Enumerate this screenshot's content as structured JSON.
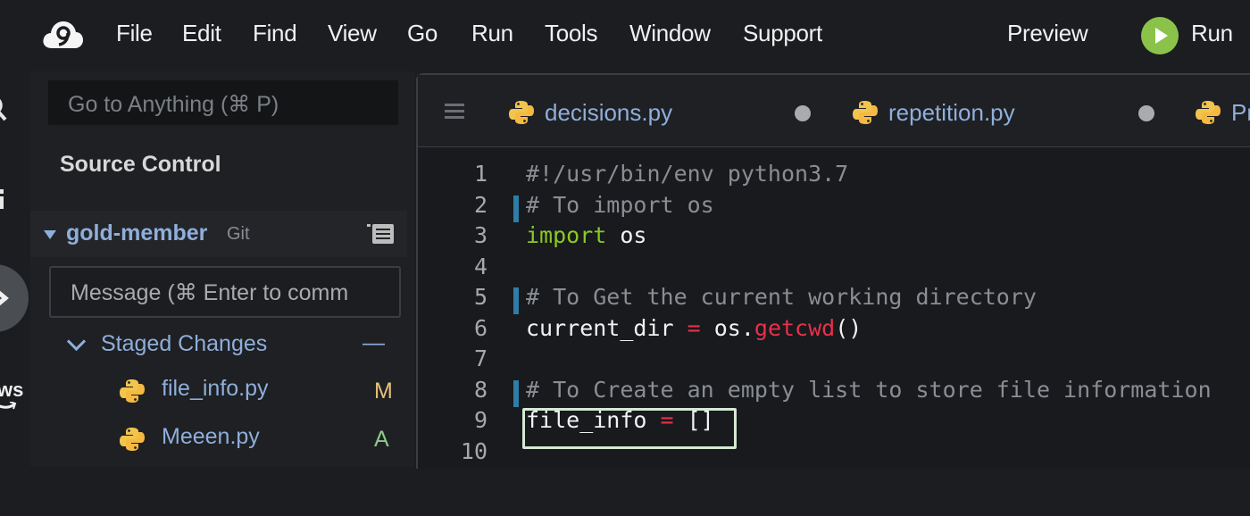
{
  "menu": {
    "items": [
      "File",
      "Edit",
      "Find",
      "View",
      "Go",
      "Run",
      "Tools",
      "Window",
      "Support"
    ],
    "preview": "Preview",
    "run": "Run"
  },
  "activity": {
    "aws_label": "ws"
  },
  "sidebar": {
    "goto_placeholder": "Go to Anything (⌘ P)",
    "title": "Source Control",
    "repo": {
      "name": "gold-member",
      "vcs": "Git"
    },
    "commit_placeholder": "Message (⌘ Enter to comm",
    "staged": {
      "label": "Staged Changes",
      "collapse": "—"
    },
    "files": [
      {
        "name": "file_info.py",
        "status": "M",
        "status_color": "#e8c17a"
      },
      {
        "name": "Meeen.py",
        "status": "A",
        "status_color": "#8fc98a"
      }
    ]
  },
  "tabs": [
    {
      "name": "decisions.py"
    },
    {
      "name": "repetition.py"
    },
    {
      "name": "Pr"
    }
  ],
  "code": {
    "lines": [
      {
        "n": "1",
        "t": "#!/usr/bin/env python3.7"
      },
      {
        "n": "2",
        "t": "# To import os"
      },
      {
        "n": "3",
        "kw": "import",
        "rest": " os"
      },
      {
        "n": "4"
      },
      {
        "n": "5",
        "t": "# To Get the current working directory"
      },
      {
        "n": "6",
        "a": "current_dir ",
        "op": "=",
        "b": " os.",
        "fn": "getcwd",
        "c": "()"
      },
      {
        "n": "7"
      },
      {
        "n": "8",
        "t": "# To Create an empty list to store file information"
      },
      {
        "n": "9",
        "a": "file_info ",
        "op": "=",
        "c": " []"
      },
      {
        "n": "10"
      }
    ]
  },
  "colors": {
    "accent": "#8faedb",
    "run_green": "#8bc34a",
    "keyword": "#8ac926",
    "function": "#e8304a",
    "comment": "#8a8d92",
    "change_marker": "#2d7ea8"
  }
}
